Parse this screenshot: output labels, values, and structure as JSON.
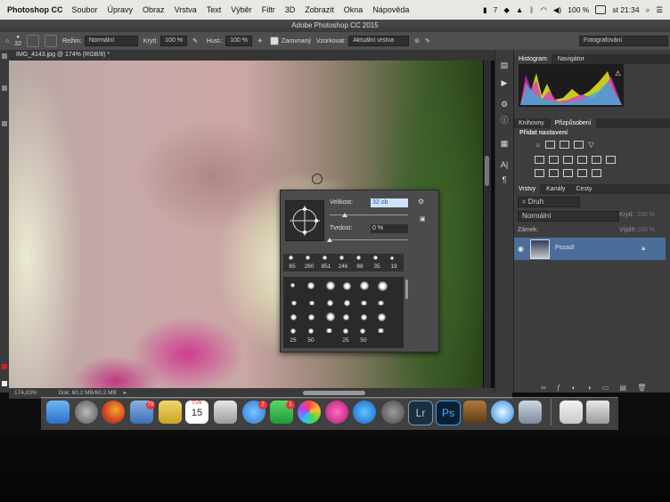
{
  "menubar": {
    "app": "Photoshop CC",
    "items": [
      "Soubor",
      "Úpravy",
      "Obraz",
      "Vrstva",
      "Text",
      "Výběr",
      "Filtr",
      "3D",
      "Zobrazit",
      "Okna",
      "Nápověda"
    ],
    "battery": "100 %",
    "clock": "st 21:34",
    "notif_count": "7"
  },
  "window": {
    "title": "Adobe Photoshop CC 2015"
  },
  "options": {
    "brush_size": "32",
    "mode_label": "Režim:",
    "mode_value": "Normální",
    "opacity_label": "Krytí:",
    "opacity_value": "100 %",
    "flow_label": "Hust.:",
    "flow_value": "100 %",
    "align_label": "Zarovnaný",
    "sample_label": "Vzorkovat:",
    "sample_value": "Aktuální vrstva",
    "workspace": "Fotografování"
  },
  "document": {
    "tab": "IMG_4143.jpg @ 174% (RGB/8) *",
    "zoom": "174,03%",
    "doc_size": "Dok: 60,2 MB/60,2 MB"
  },
  "panels": {
    "top_tabs": [
      "Histogram",
      "Navigátor"
    ],
    "mid_tabs": [
      "Knihovny",
      "Přizpůsobení"
    ],
    "add_adjustment": "Přidat nastavení",
    "layer_tabs": [
      "Vrstvy",
      "Kanály",
      "Cesty"
    ],
    "filter_kind": "Druh",
    "blend_mode": "Normální",
    "opacity_label": "Krytí:",
    "opacity_value": "100 %",
    "lock_label": "Zámek:",
    "fill_label": "Výplň:",
    "fill_value": "100 %",
    "layer_name": "Pozadí"
  },
  "brush_popup": {
    "size_label": "Velikost:",
    "size_value": "32 ob",
    "size_level": 0.19,
    "hardness_label": "Tvrdost:",
    "hardness_value": "0 %",
    "hardness_level": 0.0,
    "recent_sizes": [
      "65",
      "260",
      "851",
      "246",
      "88",
      "35",
      "19"
    ],
    "preset_labels": [
      "25",
      "50",
      "25",
      "50"
    ]
  },
  "dock": {
    "mail_badge": "79",
    "messages_badge": "2",
    "facetime_badge": "1",
    "calendar_month": "ČVN",
    "calendar_day": "15",
    "apps": [
      "Finder",
      "Launchpad",
      "Firefox",
      "Náhled",
      "Poznámky",
      "Kalendář",
      "Fotky",
      "Zprávy",
      "FaceTime",
      "Fotografie",
      "iTunes",
      "App Store",
      "Předvolby systému",
      "Lightroom",
      "Photoshop",
      "Skript",
      "Safari",
      "Fotky v rámečku",
      "Dokumenty",
      "Koš"
    ],
    "lr_label": "Lr",
    "ps_label": "Ps"
  }
}
